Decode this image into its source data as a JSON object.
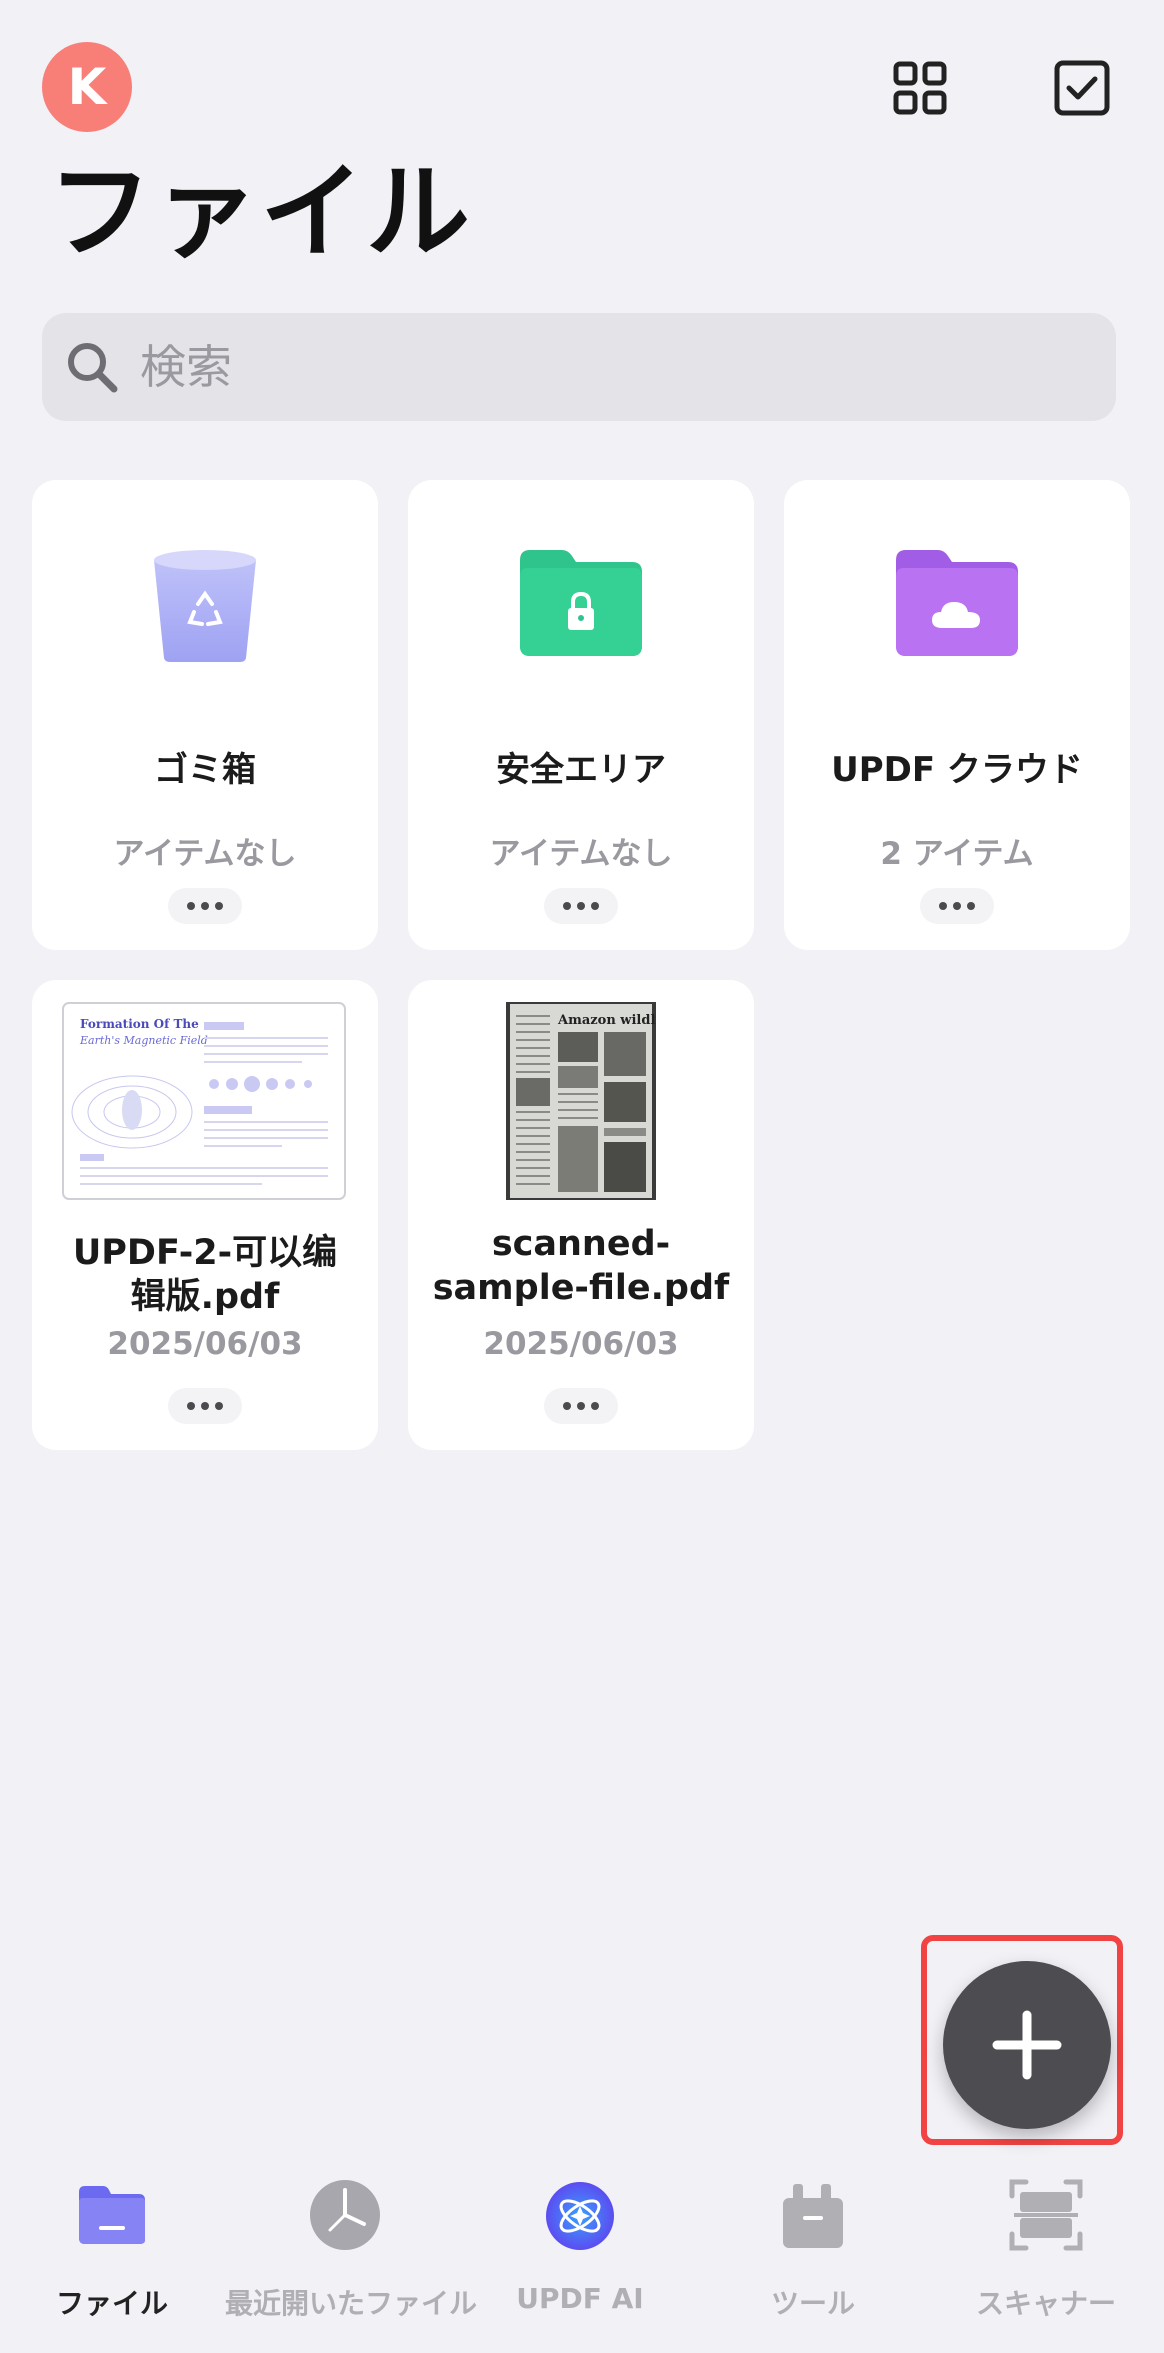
{
  "header": {
    "avatar_initial": "K",
    "title": "ファイル",
    "icons": [
      "grid-view-icon",
      "select-checkbox-icon"
    ]
  },
  "search": {
    "placeholder": "検索"
  },
  "folders": [
    {
      "name": "ゴミ箱",
      "sub": "アイテムなし",
      "icon": "trash-icon"
    },
    {
      "name": "安全エリア",
      "sub": "アイテムなし",
      "icon": "locked-folder-icon"
    },
    {
      "name": "UPDF クラウド",
      "sub": "2 アイテム",
      "icon": "cloud-folder-icon"
    }
  ],
  "files": [
    {
      "name_line1": "UPDF-2-可以编",
      "name_line2": "辑版.pdf",
      "date": "2025/06/03",
      "thumb_title1": "Formation Of The",
      "thumb_title2": "Earth's Magnetic Field"
    },
    {
      "name_line1": "scanned-",
      "name_line2": "sample-file.pdf",
      "date": "2025/06/03",
      "thumb_title1": "Amazon wildlife"
    }
  ],
  "fab": {
    "icon": "plus-icon"
  },
  "tabs": [
    {
      "label": "ファイル",
      "icon": "folder-icon",
      "active": true
    },
    {
      "label": "最近開いたファイル",
      "icon": "clock-icon",
      "active": false
    },
    {
      "label": "UPDF AI",
      "icon": "ai-sparkle-icon",
      "active": false
    },
    {
      "label": "ツール",
      "icon": "toolbox-icon",
      "active": false
    },
    {
      "label": "スキャナー",
      "icon": "scanner-icon",
      "active": false
    }
  ],
  "colors": {
    "background": "#f2f1f6",
    "avatar": "#f77f78",
    "trash": "#a9acf5",
    "secure_folder": "#2fc48b",
    "cloud_folder": "#b16cf0",
    "active_tab": "#7a78f2",
    "highlight": "#f14343"
  }
}
